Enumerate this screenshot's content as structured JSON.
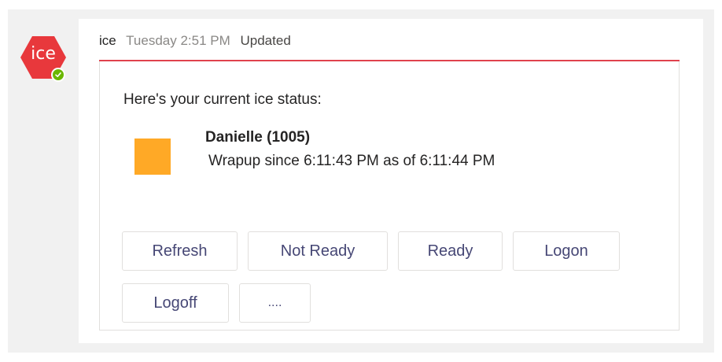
{
  "avatar": {
    "text": "ice",
    "color": "#e8383c",
    "presence": "available",
    "presence_color": "#6bb700"
  },
  "header": {
    "sender": "ice",
    "timestamp": "Tuesday 2:51 PM",
    "status": "Updated"
  },
  "card": {
    "intro": "Here's your current ice status:",
    "agent_name": "Danielle (1005)",
    "agent_status": "Wrapup since 6:11:43 PM as of 6:11:44 PM",
    "status_color": "#ffa926",
    "accent_color": "#e0424d"
  },
  "actions": {
    "refresh": "Refresh",
    "not_ready": "Not Ready",
    "ready": "Ready",
    "logon": "Logon",
    "logoff": "Logoff",
    "more": "...."
  }
}
